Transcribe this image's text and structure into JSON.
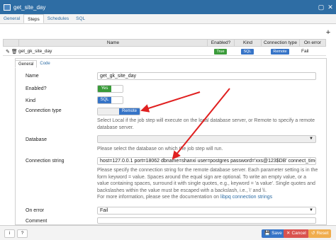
{
  "window": {
    "title": "get_site_day"
  },
  "tabs": [
    {
      "label": "General"
    },
    {
      "label": "Steps"
    },
    {
      "label": "Schedules"
    },
    {
      "label": "SQL"
    }
  ],
  "grid": {
    "columns": [
      "Name",
      "Enabled?",
      "Kind",
      "Connection type",
      "On error"
    ],
    "row": {
      "name": "get_gk_site_day",
      "enabled": "True",
      "kind": "SQL",
      "connection_type": "Remote",
      "on_error": "Fail"
    }
  },
  "subtabs": [
    {
      "label": "General"
    },
    {
      "label": "Code"
    }
  ],
  "form": {
    "name_label": "Name",
    "name_value": "get_gk_site_day",
    "enabled_label": "Enabled?",
    "enabled_value": "Yes",
    "kind_label": "Kind",
    "kind_value": "SQL",
    "conn_type_label": "Connection type",
    "conn_type_value": "Remote",
    "conn_type_help": "Select Local if the job step will execute on the local database server, or Remote to specify a remote database server.",
    "database_label": "Database",
    "database_help": "Please select the database on which the job step will run.",
    "conn_string_label": "Connection string",
    "conn_string_value": "host=127.0.0.1 port=18062 dbname=shanxi user=postgres password='xxs@123$DB' connect_timeout=10",
    "conn_string_help": "Please specify the connection string for the remote database server. Each parameter setting is in the form keyword = value. Spaces around the equal sign are optional. To write an empty value, or a value containing spaces, surround it with single quotes, e.g., keyword = 'a value'. Single quotes and backslashes within the value must be escaped with a backslash, i.e., \\' and \\\\.",
    "conn_string_more": "For more information, please see the documentation on",
    "conn_string_link": "libpq connection strings",
    "on_error_label": "On error",
    "on_error_value": "Fail",
    "comment_label": "Comment"
  },
  "footer": {
    "info": "i",
    "help": "?",
    "save": "Save",
    "cancel": "Cancel",
    "reset": "Reset"
  },
  "colors": {
    "accent": "#3674c7",
    "title_bar": "#2e6da4",
    "success": "#3a9b3a",
    "danger": "#d9534f",
    "warning": "#f0ad4e",
    "annotation_arrow": "#e02020"
  },
  "icons": {
    "window": "window-icon",
    "maximize": "maximize-icon",
    "close": "close-icon",
    "add": "plus-icon",
    "edit": "edit-icon",
    "delete": "trash-icon",
    "info": "info-icon",
    "help": "help-icon",
    "save": "save-icon",
    "cancel": "close-icon",
    "reset": "reset-icon"
  }
}
